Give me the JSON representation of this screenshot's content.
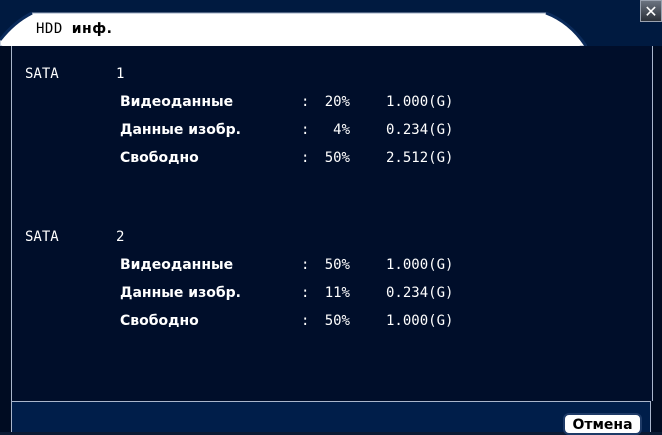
{
  "window": {
    "title_prefix": "HDD",
    "title_main": "инф.",
    "close_label": "✕"
  },
  "disks": [
    {
      "type": "SATA",
      "number": "1",
      "rows": [
        {
          "label": "Видеоданные",
          "colon": ":",
          "percent": "20%",
          "size": "1.000(G)"
        },
        {
          "label": "Данные изобр.",
          "colon": ":",
          "percent": "4%",
          "size": "0.234(G)"
        },
        {
          "label": "Свободно",
          "colon": ":",
          "percent": "50%",
          "size": "2.512(G)"
        }
      ]
    },
    {
      "type": "SATA",
      "number": "2",
      "rows": [
        {
          "label": "Видеоданные",
          "colon": ":",
          "percent": "50%",
          "size": "1.000(G)"
        },
        {
          "label": "Данные изобр.",
          "colon": ":",
          "percent": "11%",
          "size": "0.234(G)"
        },
        {
          "label": "Свободно",
          "colon": ":",
          "percent": "50%",
          "size": "1.000(G)"
        }
      ]
    }
  ],
  "footer": {
    "cancel_label": "Отмена"
  },
  "colors": {
    "background": "#000e2a",
    "titlebar": "#001a40",
    "tab": "#ffffff",
    "text": "#ffffff"
  }
}
